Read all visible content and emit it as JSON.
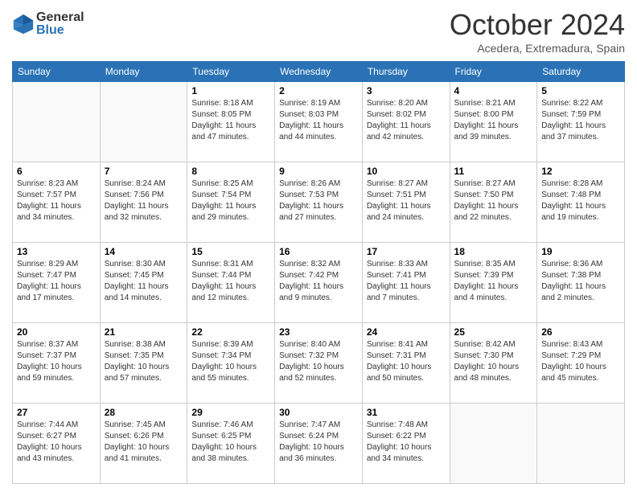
{
  "logo": {
    "general": "General",
    "blue": "Blue"
  },
  "header": {
    "month": "October 2024",
    "location": "Acedera, Extremadura, Spain"
  },
  "weekdays": [
    "Sunday",
    "Monday",
    "Tuesday",
    "Wednesday",
    "Thursday",
    "Friday",
    "Saturday"
  ],
  "weeks": [
    [
      {
        "day": null
      },
      {
        "day": null
      },
      {
        "day": "1",
        "sunrise": "Sunrise: 8:18 AM",
        "sunset": "Sunset: 8:05 PM",
        "daylight": "Daylight: 11 hours and 47 minutes."
      },
      {
        "day": "2",
        "sunrise": "Sunrise: 8:19 AM",
        "sunset": "Sunset: 8:03 PM",
        "daylight": "Daylight: 11 hours and 44 minutes."
      },
      {
        "day": "3",
        "sunrise": "Sunrise: 8:20 AM",
        "sunset": "Sunset: 8:02 PM",
        "daylight": "Daylight: 11 hours and 42 minutes."
      },
      {
        "day": "4",
        "sunrise": "Sunrise: 8:21 AM",
        "sunset": "Sunset: 8:00 PM",
        "daylight": "Daylight: 11 hours and 39 minutes."
      },
      {
        "day": "5",
        "sunrise": "Sunrise: 8:22 AM",
        "sunset": "Sunset: 7:59 PM",
        "daylight": "Daylight: 11 hours and 37 minutes."
      }
    ],
    [
      {
        "day": "6",
        "sunrise": "Sunrise: 8:23 AM",
        "sunset": "Sunset: 7:57 PM",
        "daylight": "Daylight: 11 hours and 34 minutes."
      },
      {
        "day": "7",
        "sunrise": "Sunrise: 8:24 AM",
        "sunset": "Sunset: 7:56 PM",
        "daylight": "Daylight: 11 hours and 32 minutes."
      },
      {
        "day": "8",
        "sunrise": "Sunrise: 8:25 AM",
        "sunset": "Sunset: 7:54 PM",
        "daylight": "Daylight: 11 hours and 29 minutes."
      },
      {
        "day": "9",
        "sunrise": "Sunrise: 8:26 AM",
        "sunset": "Sunset: 7:53 PM",
        "daylight": "Daylight: 11 hours and 27 minutes."
      },
      {
        "day": "10",
        "sunrise": "Sunrise: 8:27 AM",
        "sunset": "Sunset: 7:51 PM",
        "daylight": "Daylight: 11 hours and 24 minutes."
      },
      {
        "day": "11",
        "sunrise": "Sunrise: 8:27 AM",
        "sunset": "Sunset: 7:50 PM",
        "daylight": "Daylight: 11 hours and 22 minutes."
      },
      {
        "day": "12",
        "sunrise": "Sunrise: 8:28 AM",
        "sunset": "Sunset: 7:48 PM",
        "daylight": "Daylight: 11 hours and 19 minutes."
      }
    ],
    [
      {
        "day": "13",
        "sunrise": "Sunrise: 8:29 AM",
        "sunset": "Sunset: 7:47 PM",
        "daylight": "Daylight: 11 hours and 17 minutes."
      },
      {
        "day": "14",
        "sunrise": "Sunrise: 8:30 AM",
        "sunset": "Sunset: 7:45 PM",
        "daylight": "Daylight: 11 hours and 14 minutes."
      },
      {
        "day": "15",
        "sunrise": "Sunrise: 8:31 AM",
        "sunset": "Sunset: 7:44 PM",
        "daylight": "Daylight: 11 hours and 12 minutes."
      },
      {
        "day": "16",
        "sunrise": "Sunrise: 8:32 AM",
        "sunset": "Sunset: 7:42 PM",
        "daylight": "Daylight: 11 hours and 9 minutes."
      },
      {
        "day": "17",
        "sunrise": "Sunrise: 8:33 AM",
        "sunset": "Sunset: 7:41 PM",
        "daylight": "Daylight: 11 hours and 7 minutes."
      },
      {
        "day": "18",
        "sunrise": "Sunrise: 8:35 AM",
        "sunset": "Sunset: 7:39 PM",
        "daylight": "Daylight: 11 hours and 4 minutes."
      },
      {
        "day": "19",
        "sunrise": "Sunrise: 8:36 AM",
        "sunset": "Sunset: 7:38 PM",
        "daylight": "Daylight: 11 hours and 2 minutes."
      }
    ],
    [
      {
        "day": "20",
        "sunrise": "Sunrise: 8:37 AM",
        "sunset": "Sunset: 7:37 PM",
        "daylight": "Daylight: 10 hours and 59 minutes."
      },
      {
        "day": "21",
        "sunrise": "Sunrise: 8:38 AM",
        "sunset": "Sunset: 7:35 PM",
        "daylight": "Daylight: 10 hours and 57 minutes."
      },
      {
        "day": "22",
        "sunrise": "Sunrise: 8:39 AM",
        "sunset": "Sunset: 7:34 PM",
        "daylight": "Daylight: 10 hours and 55 minutes."
      },
      {
        "day": "23",
        "sunrise": "Sunrise: 8:40 AM",
        "sunset": "Sunset: 7:32 PM",
        "daylight": "Daylight: 10 hours and 52 minutes."
      },
      {
        "day": "24",
        "sunrise": "Sunrise: 8:41 AM",
        "sunset": "Sunset: 7:31 PM",
        "daylight": "Daylight: 10 hours and 50 minutes."
      },
      {
        "day": "25",
        "sunrise": "Sunrise: 8:42 AM",
        "sunset": "Sunset: 7:30 PM",
        "daylight": "Daylight: 10 hours and 48 minutes."
      },
      {
        "day": "26",
        "sunrise": "Sunrise: 8:43 AM",
        "sunset": "Sunset: 7:29 PM",
        "daylight": "Daylight: 10 hours and 45 minutes."
      }
    ],
    [
      {
        "day": "27",
        "sunrise": "Sunrise: 7:44 AM",
        "sunset": "Sunset: 6:27 PM",
        "daylight": "Daylight: 10 hours and 43 minutes."
      },
      {
        "day": "28",
        "sunrise": "Sunrise: 7:45 AM",
        "sunset": "Sunset: 6:26 PM",
        "daylight": "Daylight: 10 hours and 41 minutes."
      },
      {
        "day": "29",
        "sunrise": "Sunrise: 7:46 AM",
        "sunset": "Sunset: 6:25 PM",
        "daylight": "Daylight: 10 hours and 38 minutes."
      },
      {
        "day": "30",
        "sunrise": "Sunrise: 7:47 AM",
        "sunset": "Sunset: 6:24 PM",
        "daylight": "Daylight: 10 hours and 36 minutes."
      },
      {
        "day": "31",
        "sunrise": "Sunrise: 7:48 AM",
        "sunset": "Sunset: 6:22 PM",
        "daylight": "Daylight: 10 hours and 34 minutes."
      },
      {
        "day": null
      },
      {
        "day": null
      }
    ]
  ]
}
